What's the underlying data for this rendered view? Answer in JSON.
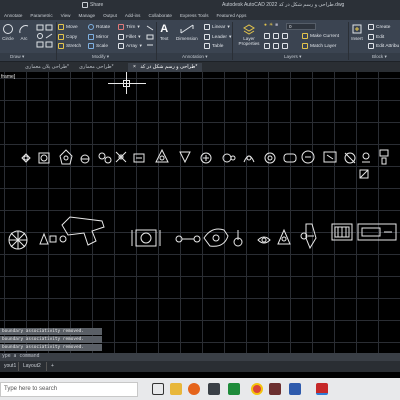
{
  "window": {
    "share_label": "Share",
    "app_title": "Autodesk AutoCAD 2022  طراحی و رسم شکل در کد.dwg"
  },
  "ribbon_tabs": [
    "Annotate",
    "Parametric",
    "View",
    "Manage",
    "Output",
    "Add-ins",
    "Collaborate",
    "Express Tools",
    "Featured Apps"
  ],
  "ribbon": {
    "draw": {
      "circle": "Circle",
      "arc": "Arc",
      "panel_title": "Draw"
    },
    "modify": {
      "move": "Move",
      "rotate": "Rotate",
      "trim": "Trim",
      "copy": "Copy",
      "mirror": "Mirror",
      "fillet": "Fillet",
      "stretch": "Stretch",
      "scale": "Scale",
      "array": "Array",
      "panel_title": "Modify"
    },
    "annotation": {
      "text": "Text",
      "dimension": "Dimension",
      "linear": "Linear",
      "leader": "Leader",
      "table": "Table",
      "panel_title": "Annotation"
    },
    "layers": {
      "layer_properties": "Layer Properties",
      "make_current": "Make Current",
      "match_layer": "Match Layer",
      "current_layer": "0",
      "panel_title": "Layers"
    },
    "block": {
      "insert": "Insert",
      "create": "Create",
      "edit": "Edit",
      "edit_attributes": "Edit Attribu",
      "panel_title": "Block"
    }
  },
  "file_tabs": [
    {
      "label": "طراحی پلان معماری*",
      "active": false
    },
    {
      "label": "طراحی معماری*",
      "active": false
    },
    {
      "label": "طراحی و رسم شکل در کد*",
      "active": true
    }
  ],
  "viewport_label": "frame]",
  "command_history": [
    "boundary associativity removed.",
    "boundary associativity removed.",
    "boundary associativity removed."
  ],
  "command_placeholder": "ype a command",
  "layout_tabs": [
    "yout1",
    "Layout2",
    "+"
  ],
  "taskbar": {
    "search_placeholder": "Type here to search"
  },
  "colors": {
    "ribbon_bg": "#3b4451",
    "canvas_bg": "#000000",
    "grid": "#2a2d33",
    "drawing_stroke": "#e8e8e8"
  }
}
